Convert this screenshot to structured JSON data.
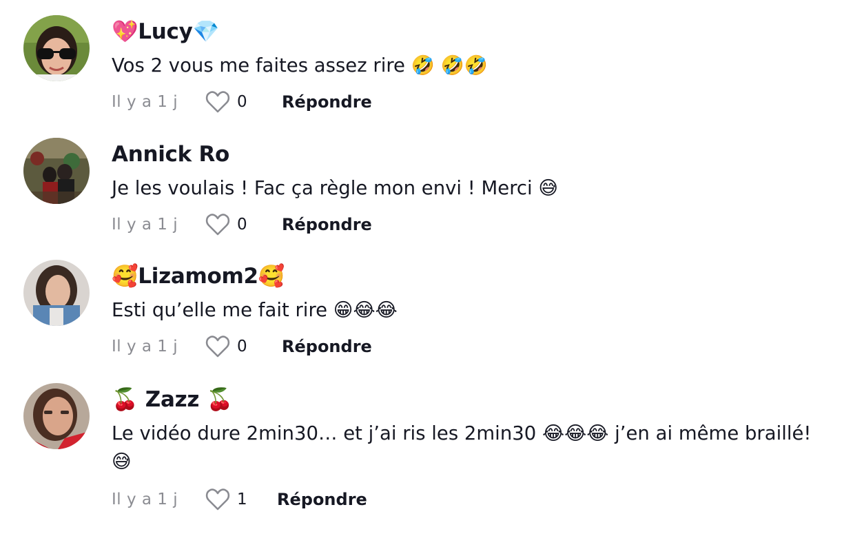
{
  "comments": [
    {
      "username": "💖Lucy💎",
      "text": "Vos 2 vous me faites assez rire 🤣 🤣🤣",
      "text_cont": "",
      "time": "Il y a 1 j",
      "likes": "0",
      "reply_label": "Répondre",
      "avatar_icon": "woman-sunglasses-avatar"
    },
    {
      "username": "Annick Ro",
      "text": "Je les voulais ! Fac ça règle mon envi ! Merci 😅",
      "text_cont": "",
      "time": "Il y a 1 j",
      "likes": "0",
      "reply_label": "Répondre",
      "avatar_icon": "couple-photo-avatar"
    },
    {
      "username": "🥰Lizamom2🥰",
      "text": "Esti qu’elle me fait rire 😁😂😂",
      "text_cont": "",
      "time": "Il y a 1 j",
      "likes": "0",
      "reply_label": "Répondre",
      "avatar_icon": "woman-selfie-avatar"
    },
    {
      "username": "🍒 Zazz 🍒",
      "text": "Le vidéo dure 2min30… et j’ai ris les 2min30 😂😂😂 j’en ai même braillé!",
      "text_cont": "😅",
      "time": "Il y a 1 j",
      "likes": "1",
      "reply_label": "Répondre",
      "avatar_icon": "woman-red-avatar"
    }
  ],
  "colors": {
    "text": "#161823",
    "meta": "#8a8b91",
    "like_outline": "#8a8b91"
  }
}
